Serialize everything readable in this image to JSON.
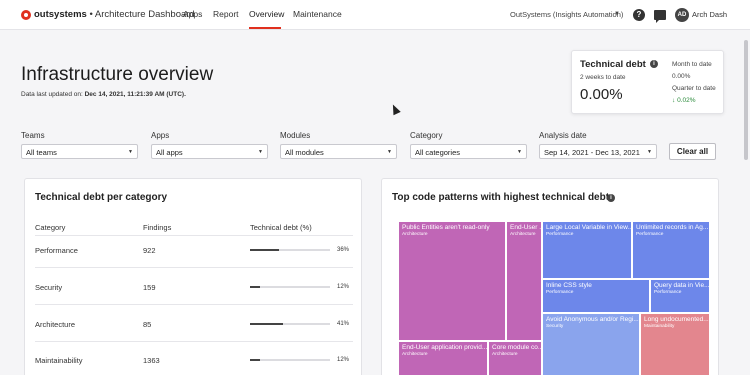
{
  "header": {
    "brand": "outsystems",
    "app_name": "Architecture Dashboard",
    "nav": [
      {
        "label": "Apps",
        "active": false
      },
      {
        "label": "Report",
        "active": false
      },
      {
        "label": "Overview",
        "active": true
      },
      {
        "label": "Maintenance",
        "active": false
      }
    ],
    "tenant": "OutSystems (Insights Automation)",
    "user_initials": "AD",
    "user_name": "Arch Dash",
    "help_icon": "question-circle-icon",
    "chat_icon": "chat-icon"
  },
  "page": {
    "title": "Infrastructure overview",
    "updated_prefix": "Data last updated on:",
    "updated_value": "Dec 14, 2021, 11:21:39 AM (UTC)."
  },
  "tech_debt_card": {
    "title": "Technical debt",
    "period": "2 weeks to date",
    "value": "0.00%",
    "month_label": "Month to date",
    "month_value": "0.00%",
    "quarter_label": "Quarter to date",
    "quarter_delta": "0.02%",
    "quarter_delta_color": "#2a8a3a"
  },
  "filters": {
    "teams": {
      "label": "Teams",
      "value": "All teams"
    },
    "apps": {
      "label": "Apps",
      "value": "All apps"
    },
    "modules": {
      "label": "Modules",
      "value": "All modules"
    },
    "category": {
      "label": "Category",
      "value": "All categories"
    },
    "analysis": {
      "label": "Analysis date",
      "value": "Sep 14, 2021 - Dec 13, 2021"
    },
    "clear_label": "Clear all"
  },
  "category_table": {
    "title": "Technical debt per category",
    "headers": [
      "Category",
      "Findings",
      "Technical debt (%)"
    ],
    "rows": [
      {
        "category": "Performance",
        "findings": "922",
        "debt_pct": 36,
        "debt_label": "36%"
      },
      {
        "category": "Security",
        "findings": "159",
        "debt_pct": 12,
        "debt_label": "12%"
      },
      {
        "category": "Architecture",
        "findings": "85",
        "debt_pct": 41,
        "debt_label": "41%"
      },
      {
        "category": "Maintainability",
        "findings": "1363",
        "debt_pct": 12,
        "debt_label": "12%"
      }
    ]
  },
  "patterns": {
    "title": "Top code patterns with highest technical debt",
    "cells": [
      {
        "name": "Public Entities aren't read-only",
        "category": "Architecture"
      },
      {
        "name": "End-User ...",
        "category": "Architecture"
      },
      {
        "name": "Large Local Variable in View...",
        "category": "Performance"
      },
      {
        "name": "Unlimited records in Ag...",
        "category": "Performance"
      },
      {
        "name": "Inline CSS style",
        "category": "Performance"
      },
      {
        "name": "Query data in Vie...",
        "category": "Performance"
      },
      {
        "name": "Avoid Anonymous and/or Regi...",
        "category": "Security"
      },
      {
        "name": "Long undocumented...",
        "category": "Maintainability"
      },
      {
        "name": "End-User application provid...",
        "category": "Architecture"
      },
      {
        "name": "Core module co...",
        "category": "Architecture"
      }
    ]
  }
}
